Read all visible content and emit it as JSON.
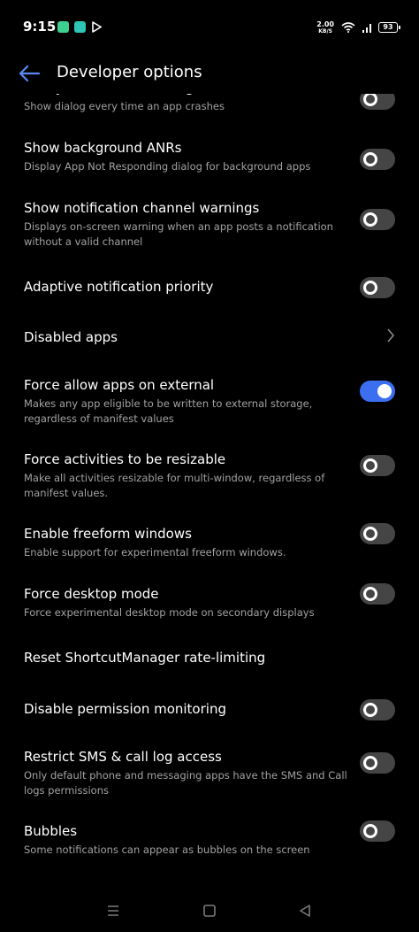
{
  "status_bar": {
    "time": "9:15",
    "net_speed_value": "2.00",
    "net_speed_unit": "KB/S",
    "battery": "93"
  },
  "app_bar": {
    "title": "Developer options"
  },
  "settings": [
    {
      "title": "Always show crash dialog",
      "subtitle": "Show dialog every time an app crashes",
      "control": "toggle",
      "on": false
    },
    {
      "title": "Show background ANRs",
      "subtitle": "Display App Not Responding dialog for background apps",
      "control": "toggle",
      "on": false
    },
    {
      "title": "Show notification channel warnings",
      "subtitle": "Displays on-screen warning when an app posts a notification without a valid channel",
      "control": "toggle",
      "on": false
    },
    {
      "title": "Adaptive notification priority",
      "subtitle": "",
      "control": "toggle",
      "on": false
    },
    {
      "title": "Disabled apps",
      "subtitle": "",
      "control": "chevron",
      "on": false
    },
    {
      "title": "Force allow apps on external",
      "subtitle": "Makes any app eligible to be written to external storage, regardless of manifest values",
      "control": "toggle",
      "on": true
    },
    {
      "title": "Force activities to be resizable",
      "subtitle": "Make all activities resizable for multi-window, regardless of manifest values.",
      "control": "toggle",
      "on": false
    },
    {
      "title": "Enable freeform windows",
      "subtitle": "Enable support for experimental freeform windows.",
      "control": "toggle",
      "on": false
    },
    {
      "title": "Force desktop mode",
      "subtitle": "Force experimental desktop mode on secondary displays",
      "control": "toggle",
      "on": false
    },
    {
      "title": "Reset ShortcutManager rate-limiting",
      "subtitle": "",
      "control": "none",
      "on": false
    },
    {
      "title": "Disable permission monitoring",
      "subtitle": "",
      "control": "toggle",
      "on": false
    },
    {
      "title": "Restrict SMS & call log access",
      "subtitle": "Only default phone and messaging apps have the SMS and Call logs permissions",
      "control": "toggle",
      "on": false
    },
    {
      "title": "Bubbles",
      "subtitle": "Some notifications can appear as bubbles on the screen",
      "control": "toggle",
      "on": false
    }
  ],
  "colors": {
    "background": "#000000",
    "accent": "#3c6ff0",
    "toggle_off": "#454545",
    "subtitle": "#a2a2a2"
  },
  "nav_bar": {
    "icons": [
      "menu-icon",
      "home-square-icon",
      "back-triangle-icon"
    ]
  }
}
